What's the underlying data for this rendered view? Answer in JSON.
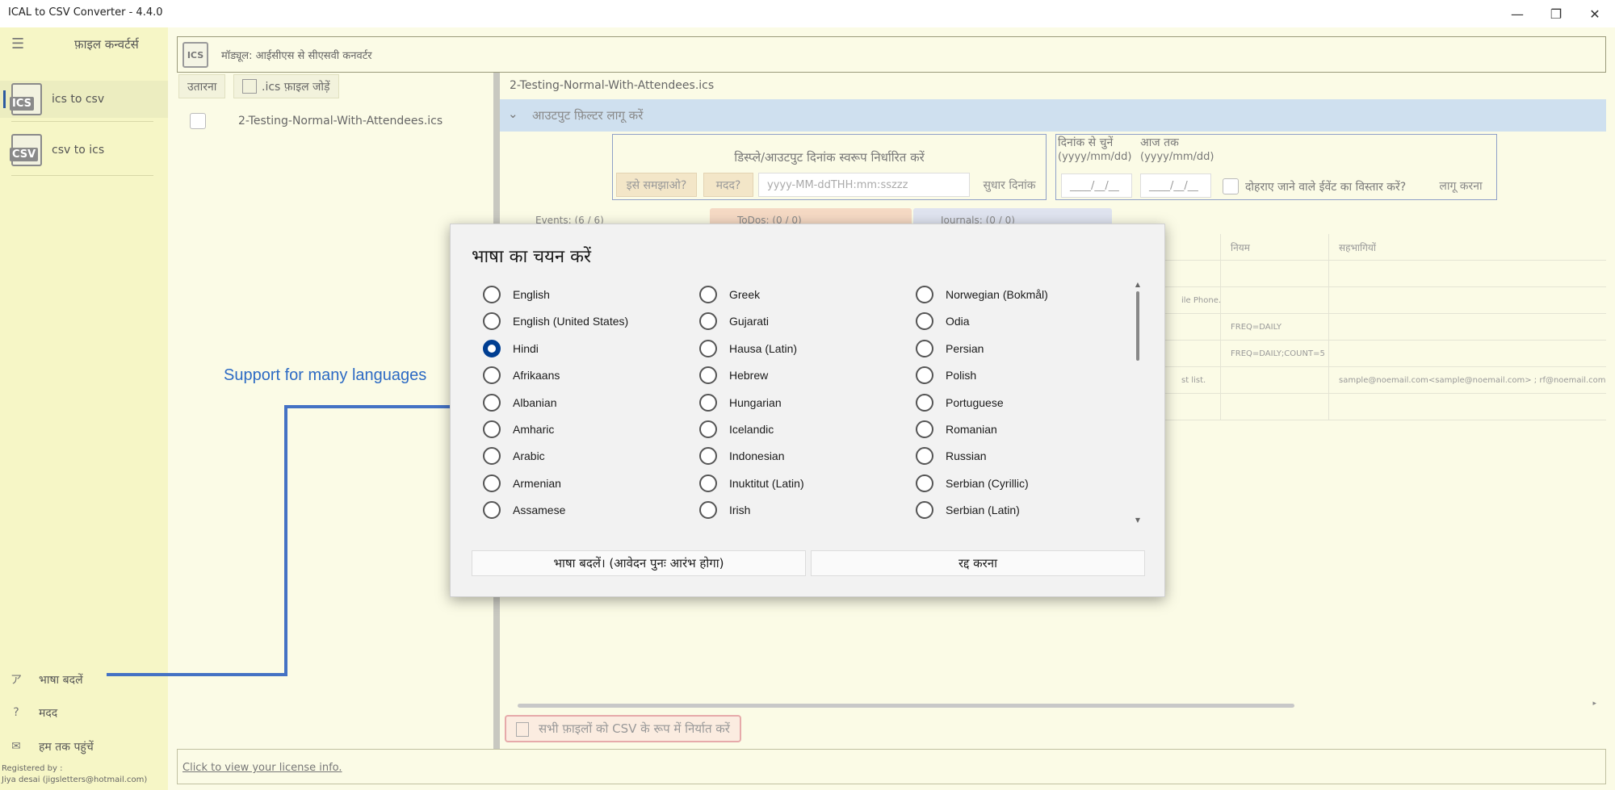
{
  "window": {
    "title": "ICAL to CSV Converter -  4.4.0",
    "minimize_glyph": "—",
    "maximize_glyph": "❐",
    "close_glyph": "✕"
  },
  "sidebar": {
    "title": "फ़ाइल कन्वर्टर्स",
    "items": [
      {
        "label": "ics to csv",
        "icon_text": "ICS",
        "icon": "ics-file-icon"
      },
      {
        "label": "csv to ics",
        "icon_text": "CSV",
        "icon": "csv-file-icon"
      }
    ],
    "bottom_items": [
      {
        "label": "भाषा बदलें",
        "icon": "language-icon"
      },
      {
        "label": "मदद",
        "icon": "help-icon"
      },
      {
        "label": "हम तक पहुंचें",
        "icon": "mail-icon"
      }
    ],
    "registered_line1": "Registered by :",
    "registered_line2": "Jiya desai (jigsletters@hotmail.com)"
  },
  "module_bar": {
    "badge": "ICS",
    "text": "मॉड्यूल: आईसीएस से सीएसवी कनवर्टर"
  },
  "left_panel": {
    "download_label": "उतारना",
    "add_label": ".ics फ़ाइल जोड़ें",
    "file_name": "2-Testing-Normal-With-Attendees.ics"
  },
  "right_panel": {
    "file_name": "2-Testing-Normal-With-Attendees.ics",
    "filter_title": "आउटपुट फ़िल्टर लागू करें",
    "date_format_title": "डिस्प्ले/आउटपुट दिनांक स्वरूप निर्धारित करें",
    "explain_btn": "इसे समझाओ?",
    "help_btn": "मदद?",
    "format_placeholder": "yyyy-MM-ddTHH:mm:sszzz",
    "fix_date_btn": "सुधार दिनांक",
    "choose_from_date": "दिनांक से चुनें",
    "to_date": "आज तक",
    "date_hint": "(yyyy/mm/dd)",
    "date_placeholder": "____/__/__",
    "expand_recurring": "दोहराए जाने वाले ईवेंट का विस्तार करें?",
    "apply_btn": "लागू करना",
    "tabs": [
      "Events: (6 / 6)",
      "ToDos: (0 / 0)",
      "Journals: (0 / 0)"
    ],
    "columns": [
      "नियम",
      "सहभागियों"
    ],
    "rows": [
      [
        "",
        ""
      ],
      [
        "ile Phone.",
        "",
        ""
      ],
      [
        "",
        "FREQ=DAILY",
        ""
      ],
      [
        "",
        "FREQ=DAILY;COUNT=5",
        ""
      ],
      [
        "st list.",
        "",
        "sample@noemail.com<sample@noemail.com> ; rf@noemail.com<rf@noe"
      ],
      [
        "",
        "",
        ""
      ]
    ],
    "export_btn": "सभी फ़ाइलों को CSV के रूप में निर्यात करें"
  },
  "license_link": "Click to view your license info.",
  "annotation": {
    "text": "Support for many languages",
    "color": "#2c6ac4"
  },
  "dialog": {
    "title": "भाषा का चयन करें",
    "selected": "Hindi",
    "columns": [
      [
        "English",
        "English (United States)",
        "Hindi",
        "Afrikaans",
        "Albanian",
        "Amharic",
        "Arabic",
        "Armenian",
        "Assamese"
      ],
      [
        "Greek",
        "Gujarati",
        "Hausa (Latin)",
        "Hebrew",
        "Hungarian",
        "Icelandic",
        "Indonesian",
        "Inuktitut (Latin)",
        "Irish"
      ],
      [
        "Norwegian (Bokmål)",
        "Odia",
        "Persian",
        "Polish",
        "Portuguese",
        "Romanian",
        "Russian",
        "Serbian (Cyrillic)",
        "Serbian (Latin)"
      ]
    ],
    "change_btn": "भाषा बदलें। (आवेदन पुनः आरंभ होगा)",
    "cancel_btn": "रद्द करना"
  },
  "colors": {
    "accent": "#003e92",
    "sidebar_bg": "#f6f6c6",
    "content_bg": "#fbfbe6"
  }
}
